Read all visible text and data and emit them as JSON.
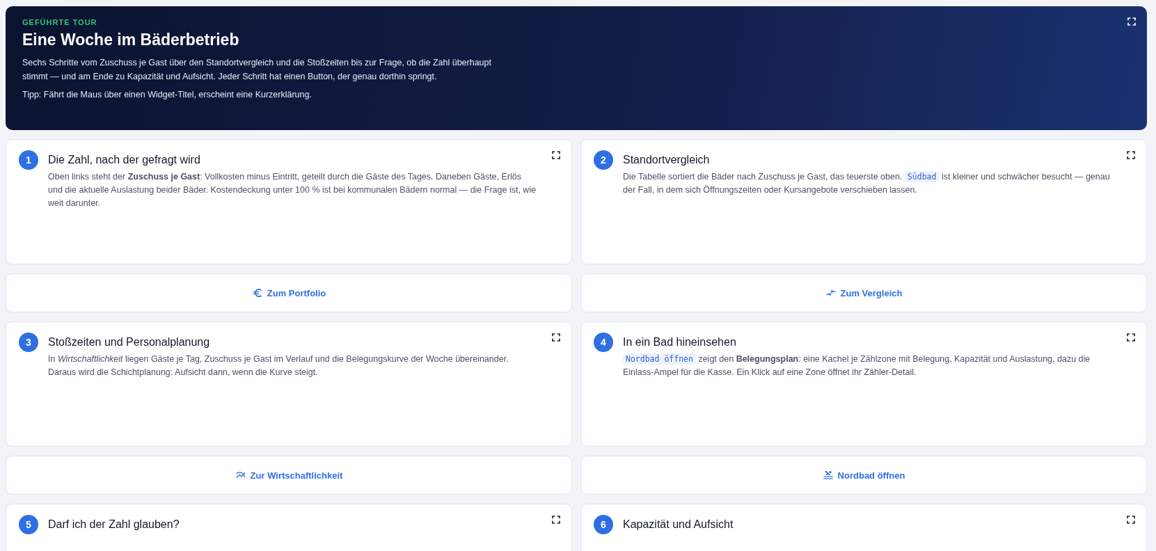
{
  "hero": {
    "eyebrow": "GEFÜHRTE TOUR",
    "title": "Eine Woche im Bäderbetrieb",
    "intro": "Sechs Schritte vom Zuschuss je Gast über den Standortvergleich und die Stoßzeiten bis zur Frage, ob die Zahl überhaupt stimmt — und am Ende zu Kapazität und Aufsicht. Jeder Schritt hat einen Button, der genau dorthin springt.",
    "tip": "Tipp: Fährt die Maus über einen Widget-Titel, erscheint eine Kurzerklärung."
  },
  "steps": [
    {
      "number": "1",
      "title": "Die Zahl, nach der gefragt wird",
      "description": [
        {
          "kind": "text",
          "text": "Oben links steht der **Zuschuss je Gast**: Vollkosten minus Eintritt, geteilt durch die Gäste des Tages. Daneben Gäste, Erlös und die aktuelle Auslastung beider Bäder. Kostendeckung unter 100 % ist bei kommunalen Bädern normal — die Frage ist, wie weit darunter."
        }
      ],
      "button": {
        "label": "Zum Portfolio",
        "kind": "euro"
      }
    },
    {
      "number": "2",
      "title": "Standortvergleich",
      "description": [
        {
          "kind": "text",
          "text": "Die Tabelle sortiert die Bäder nach Zuschuss je Gast, das teuerste oben. "
        },
        {
          "kind": "code",
          "text": "Südbad"
        },
        {
          "kind": "text",
          "text": " ist kleiner und schwächer besucht — genau der Fall, in dem sich Öffnungszeiten oder Kursangebote verschieben lassen."
        }
      ],
      "button": {
        "label": "Zum Vergleich",
        "kind": "compare"
      }
    },
    {
      "number": "3",
      "title": "Stoßzeiten und Personalplanung",
      "description": [
        {
          "kind": "text",
          "text": "In *Wirtschaftlichkeit* liegen Gäste je Tag, Zuschuss je Gast im Verlauf und die Belegungskurve der Woche übereinander. Daraus wird die Schichtplanung: Aufsicht dann, wenn die Kurve steigt."
        }
      ],
      "button": {
        "label": "Zur Wirtschaftlichkeit",
        "kind": "chart"
      }
    },
    {
      "number": "4",
      "title": "In ein Bad hineinsehen",
      "description": [
        {
          "kind": "code",
          "text": "Nordbad öffnen"
        },
        {
          "kind": "text",
          "text": " zeigt den **Belegungsplan**: eine Kachel je Zählzone mit Belegung, Kapazität und Auslastung, dazu die Einlass-Ampel für die Kasse. Ein Klick auf eine Zone öffnet ihr Zähler-Detail."
        }
      ],
      "button": {
        "label": "Nordbad öffnen",
        "kind": "pool"
      }
    },
    {
      "number": "5",
      "title": "Darf ich der Zahl glauben?"
    },
    {
      "number": "6",
      "title": "Kapazität und Aufsicht"
    }
  ]
}
